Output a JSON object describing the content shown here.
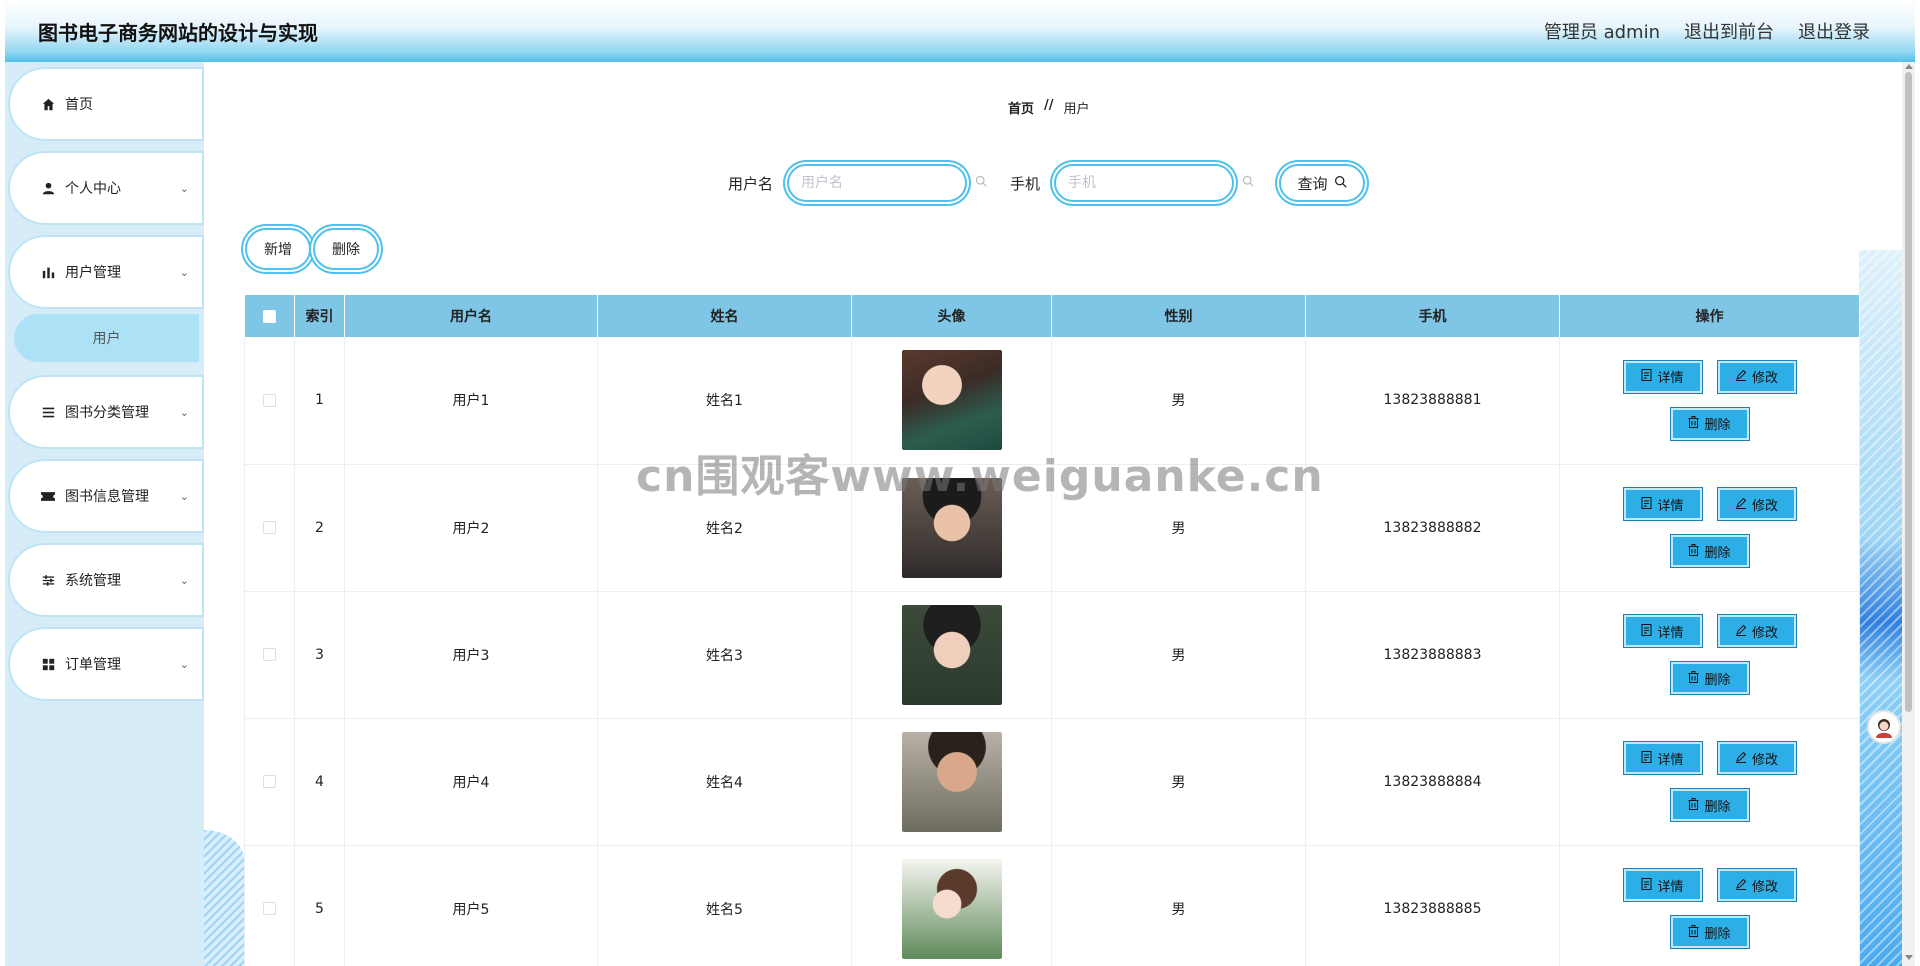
{
  "header": {
    "title": "图书电子商务网站的设计与实现",
    "admin": "管理员 admin",
    "to_front": "退出到前台",
    "logout": "退出登录"
  },
  "sidebar": {
    "items": [
      {
        "label": "首页",
        "icon": "home-icon"
      },
      {
        "label": "个人中心",
        "icon": "user-icon"
      },
      {
        "label": "用户管理",
        "icon": "bar-chart-icon"
      },
      {
        "label": "图书分类管理",
        "icon": "list-icon"
      },
      {
        "label": "图书信息管理",
        "icon": "ticket-icon"
      },
      {
        "label": "系统管理",
        "icon": "sliders-icon"
      },
      {
        "label": "订单管理",
        "icon": "grid-icon"
      }
    ],
    "sub_active": "用户"
  },
  "breadcrumb": {
    "home": "首页",
    "sep": "//",
    "current": "用户"
  },
  "search": {
    "username_label": "用户名",
    "username_placeholder": "用户名",
    "phone_label": "手机",
    "phone_placeholder": "手机",
    "query_label": "查询"
  },
  "toolbar": {
    "add_label": "新增",
    "delete_label": "删除"
  },
  "table": {
    "headers": [
      "索引",
      "用户名",
      "姓名",
      "头像",
      "性别",
      "手机",
      "操作"
    ],
    "rows": [
      {
        "index": "1",
        "username": "用户1",
        "name": "姓名1",
        "gender": "男",
        "phone": "13823888881"
      },
      {
        "index": "2",
        "username": "用户2",
        "name": "姓名2",
        "gender": "男",
        "phone": "13823888882"
      },
      {
        "index": "3",
        "username": "用户3",
        "name": "姓名3",
        "gender": "男",
        "phone": "13823888883"
      },
      {
        "index": "4",
        "username": "用户4",
        "name": "姓名4",
        "gender": "男",
        "phone": "13823888884"
      },
      {
        "index": "5",
        "username": "用户5",
        "name": "姓名5",
        "gender": "男",
        "phone": "13823888885"
      }
    ],
    "ops": {
      "detail": "详情",
      "edit": "修改",
      "delete": "删除"
    }
  },
  "watermark": "cn围观客www.weiguanke.cn",
  "colors": {
    "accent": "#2eaee6",
    "header_gradient_end": "#52bfe8",
    "table_header": "#7fc6e6",
    "sidebar_bg": "#d6edf8"
  }
}
